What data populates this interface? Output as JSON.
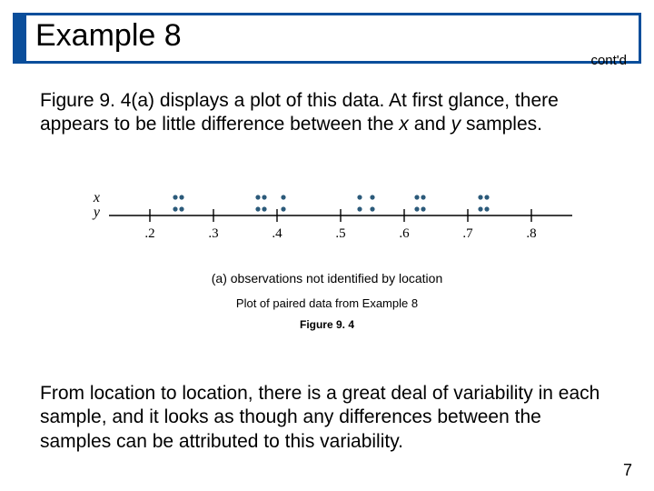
{
  "title": "Example 8",
  "contd": "cont'd",
  "paragraph1": "Figure 9. 4(a) displays a plot of this data. At first glance, there appears to be little difference between the x and y samples.",
  "paragraph2": "From location to location, there is a great deal of variability in each sample, and it looks as though any differences between the samples can be attributed to this variability.",
  "fig_sub_a": "(a) observations not identified by location",
  "fig_caption": "Plot of paired data from Example 8",
  "fig_label": "Figure 9. 4",
  "page_number": "7",
  "chart_data": {
    "type": "scatter",
    "title": "",
    "xlabel": "",
    "ylabel": "",
    "xlim": [
      0.15,
      0.85
    ],
    "ticks": [
      ".2",
      ".3",
      ".4",
      ".5",
      ".6",
      ".7",
      ".8"
    ],
    "y_levels": [
      "x",
      "y"
    ],
    "series": [
      {
        "name": "x",
        "values": [
          0.24,
          0.25,
          0.37,
          0.38,
          0.41,
          0.53,
          0.55,
          0.62,
          0.63,
          0.72,
          0.73
        ]
      },
      {
        "name": "y",
        "values": [
          0.24,
          0.25,
          0.37,
          0.38,
          0.41,
          0.53,
          0.55,
          0.62,
          0.63,
          0.72,
          0.73
        ]
      }
    ]
  },
  "italic_subs": {
    "x": "x",
    "y": "y"
  }
}
